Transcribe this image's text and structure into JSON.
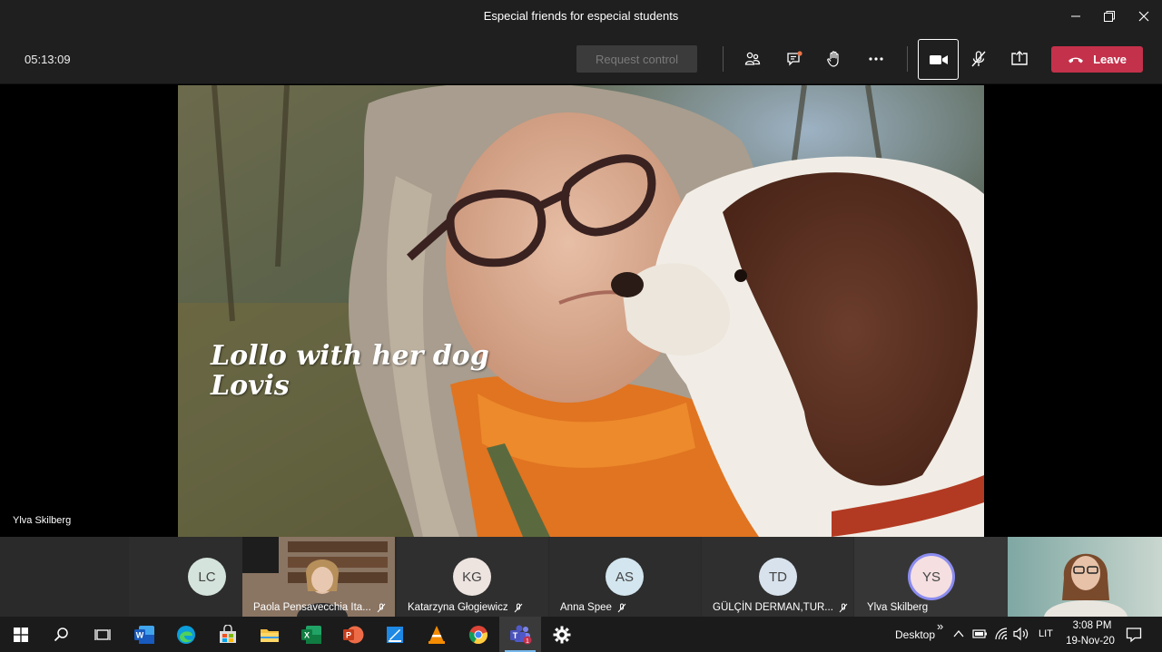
{
  "window": {
    "title": "Especial friends for especial students"
  },
  "toolbar": {
    "timer": "05:13:09",
    "request_control": "Request control",
    "leave": "Leave"
  },
  "stage": {
    "caption_line1": "Lollo with her dog",
    "caption_line2": "Lovis",
    "presenter": "Ylva Skilberg"
  },
  "participants": [
    {
      "initials": "LC",
      "name": "",
      "has_video": false,
      "avatar_color": "#d4e3dc"
    },
    {
      "initials": "",
      "name": "Paola Pensavecchia Ita...",
      "has_video": true
    },
    {
      "initials": "KG",
      "name": "Katarzyna Głogiewicz",
      "has_video": false,
      "avatar_color": "#ede3df"
    },
    {
      "initials": "AS",
      "name": "Anna Spee",
      "has_video": false,
      "avatar_color": "#d3e5ee"
    },
    {
      "initials": "TD",
      "name": "GÜLÇİN DERMAN,TUR...",
      "has_video": false,
      "avatar_color": "#d8e2ec"
    },
    {
      "initials": "YS",
      "name": "Ylva Skilberg",
      "has_video": false,
      "avatar_color": "#f5dfe0",
      "speaking": true
    },
    {
      "initials": "",
      "name": "",
      "has_video": true
    }
  ],
  "taskbar": {
    "apps": [
      "start-icon",
      "search-icon",
      "task-view-icon",
      "word-icon",
      "edge-icon",
      "store-icon",
      "file-explorer-icon",
      "excel-icon",
      "powerpoint-icon",
      "maps-icon",
      "vlc-icon",
      "chrome-icon",
      "teams-icon",
      "settings-icon"
    ],
    "teams_badge": "1",
    "desktop_label": "Desktop",
    "chevron": "»",
    "language": "LIT",
    "time": "3:08 PM",
    "date": "19-Nov-20"
  }
}
